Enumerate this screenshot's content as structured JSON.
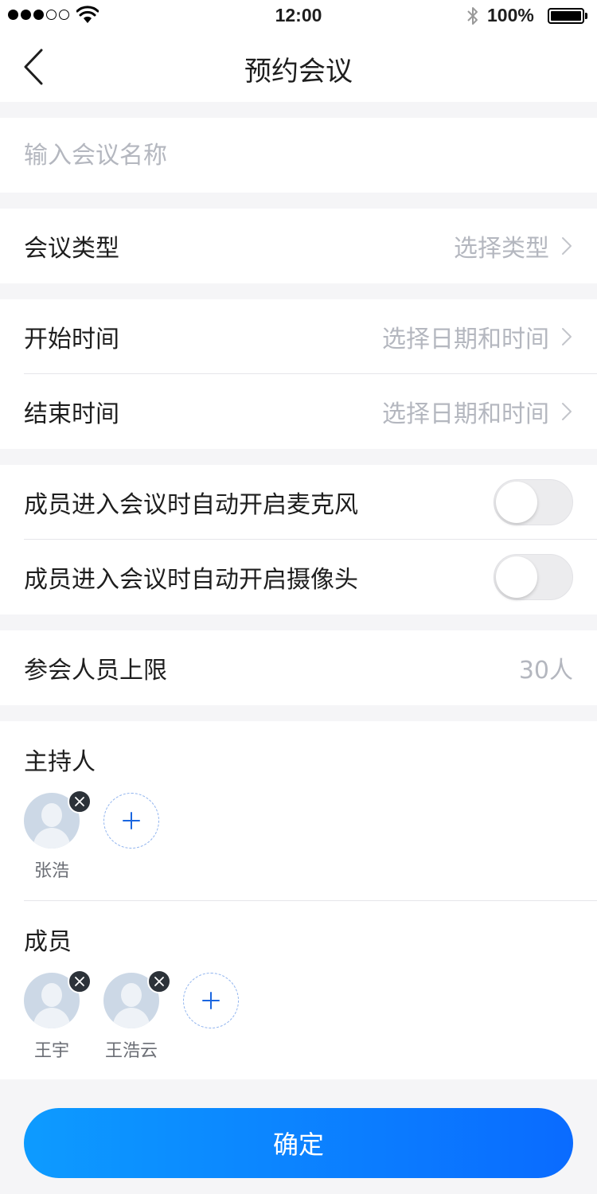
{
  "status_bar": {
    "time": "12:00",
    "battery": "100%",
    "icons": [
      "signal-icon",
      "wifi-icon",
      "bluetooth-icon",
      "battery-icon"
    ]
  },
  "nav": {
    "title": "预约会议",
    "back_icon": "chevron-left-icon"
  },
  "meeting_name": {
    "placeholder": "输入会议名称"
  },
  "meeting_type": {
    "label": "会议类型",
    "value": "选择类型"
  },
  "time": {
    "start_label": "开始时间",
    "start_value": "选择日期和时间",
    "end_label": "结束时间",
    "end_value": "选择日期和时间"
  },
  "toggles": {
    "mic_label": "成员进入会议时自动开启麦克风",
    "mic_on": false,
    "camera_label": "成员进入会议时自动开启摄像头",
    "camera_on": false
  },
  "limit": {
    "label": "参会人员上限",
    "value": "30人"
  },
  "hosts": {
    "title": "主持人",
    "people": [
      {
        "name": "张浩"
      }
    ]
  },
  "members": {
    "title": "成员",
    "people": [
      {
        "name": "王宇"
      },
      {
        "name": "王浩云"
      }
    ]
  },
  "confirm": {
    "label": "确定"
  },
  "colors": {
    "accent_start": "#0d9bff",
    "accent_end": "#0a6bff",
    "placeholder": "#b4b7bf",
    "background": "#f5f5f7"
  }
}
